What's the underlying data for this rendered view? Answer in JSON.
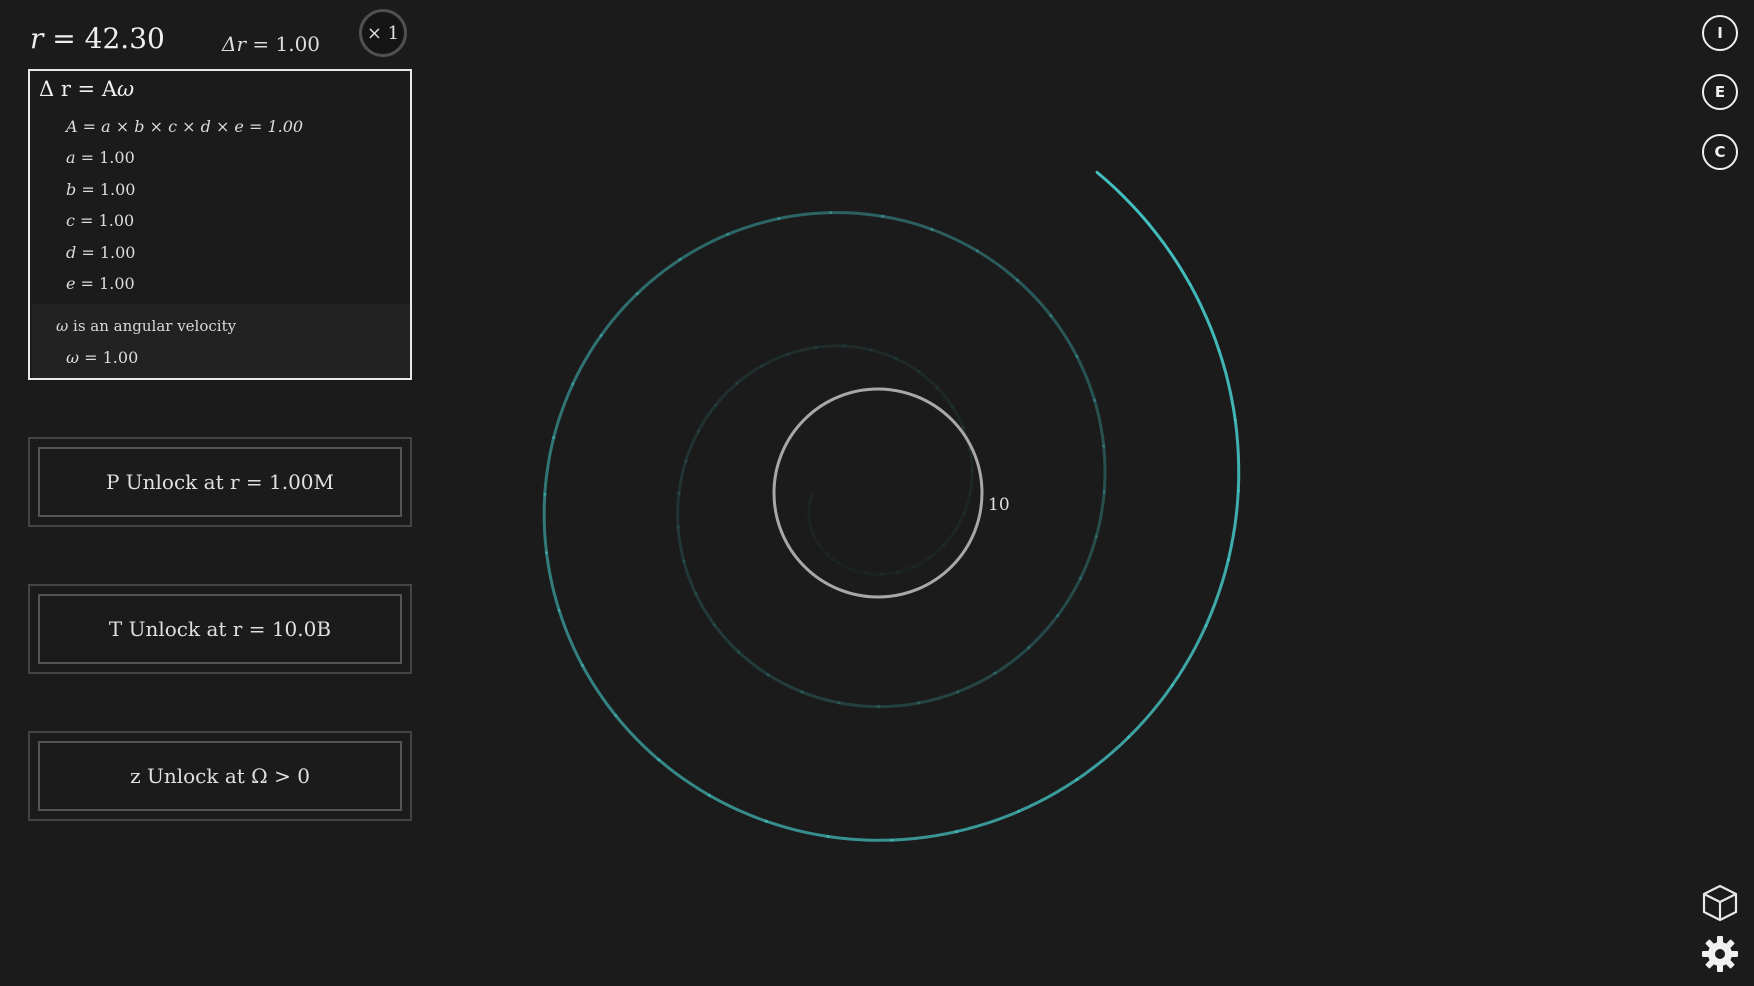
{
  "header": {
    "r_symbol": "r",
    "r_value": "42.30",
    "dr_symbol": "Δr",
    "dr_value": "1.00",
    "multiplier_label": "× 1"
  },
  "formula": {
    "title_prefix": "Δ r = A",
    "title_omega": "ω",
    "A_line": "A = a × b × c × d × e = 1.00",
    "variables": [
      {
        "name": "a",
        "value": "1.00"
      },
      {
        "name": "b",
        "value": "1.00"
      },
      {
        "name": "c",
        "value": "1.00"
      },
      {
        "name": "d",
        "value": "1.00"
      },
      {
        "name": "e",
        "value": "1.00"
      }
    ],
    "omega_symbol": "ω",
    "omega_desc": "is an angular velocity",
    "omega_value": "1.00"
  },
  "unlocks": [
    {
      "label": "P Unlock at r = 1.00M"
    },
    {
      "label": "T Unlock at r = 10.0B"
    },
    {
      "label": "z Unlock at Ω > 0"
    }
  ],
  "spiral": {
    "label": "10",
    "color_accent": "#45c4c4",
    "color_ring": "#a8a8a8"
  },
  "side_buttons": [
    {
      "label": "I"
    },
    {
      "label": "E"
    },
    {
      "label": "C"
    }
  ],
  "icons": {
    "cube": "cube-icon",
    "settings": "gear-icon"
  }
}
